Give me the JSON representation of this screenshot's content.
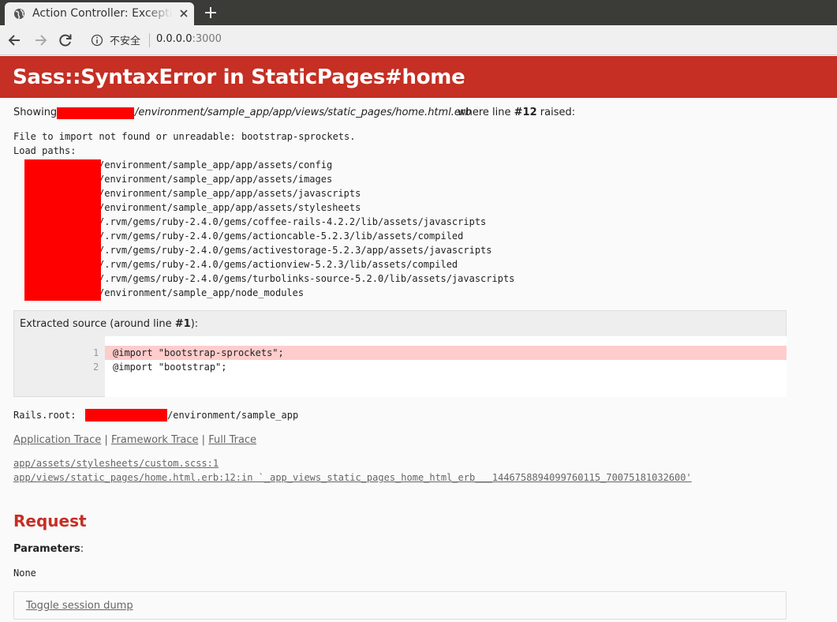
{
  "browser": {
    "tab_title": "Action Controller: Exception caught",
    "insecure_label": "不安全",
    "url_host": "0.0.0.0",
    "url_port": ":3000"
  },
  "page": {
    "error_title": "Sass::SyntaxError in StaticPages#home",
    "showing_prefix": "Showing",
    "showing_path": "/environment/sample_app/app/views/static_pages/home.html.erb",
    "showing_suffix_pre": "where line ",
    "showing_line": "#12",
    "showing_suffix_post": " raised:",
    "error_message": "File to import not found or unreadable: bootstrap-sprockets.",
    "load_paths_label": "Load paths:",
    "load_paths": [
      "/environment/sample_app/app/assets/config",
      "/environment/sample_app/app/assets/images",
      "/environment/sample_app/app/assets/javascripts",
      "/environment/sample_app/app/assets/stylesheets",
      "/.rvm/gems/ruby-2.4.0/gems/coffee-rails-4.2.2/lib/assets/javascripts",
      "/.rvm/gems/ruby-2.4.0/gems/actioncable-5.2.3/lib/assets/compiled",
      "/.rvm/gems/ruby-2.4.0/gems/activestorage-5.2.3/app/assets/javascripts",
      "/.rvm/gems/ruby-2.4.0/gems/actionview-5.2.3/lib/assets/compiled",
      "/.rvm/gems/ruby-2.4.0/gems/turbolinks-source-5.2.0/lib/assets/javascripts",
      "/environment/sample_app/node_modules"
    ],
    "extracted_label_pre": "Extracted source (around line ",
    "extracted_line": "#1",
    "extracted_label_post": "):",
    "source_lines": [
      {
        "num": "1",
        "code": "@import \"bootstrap-sprockets\";"
      },
      {
        "num": "2",
        "code": "@import \"bootstrap\";"
      }
    ],
    "rails_root_label": "Rails.root:",
    "rails_root_path": "/environment/sample_app",
    "trace_links": [
      "Application Trace",
      "Framework Trace",
      "Full Trace"
    ],
    "trace_separator": "|",
    "trace_lines": [
      "app/assets/stylesheets/custom.scss:1",
      "app/views/static_pages/home.html.erb:12:in `_app_views_static_pages_home_html_erb___1446758894099760115_70075181032600'"
    ],
    "request_title": "Request",
    "parameters_label": "Parameters",
    "parameters_colon": ":",
    "parameters_value": "None",
    "toggle_session_label": "Toggle session dump"
  },
  "colors": {
    "header_red": "#c52f24",
    "redaction": "#ff0000",
    "highlight_line": "#ffcccc"
  }
}
